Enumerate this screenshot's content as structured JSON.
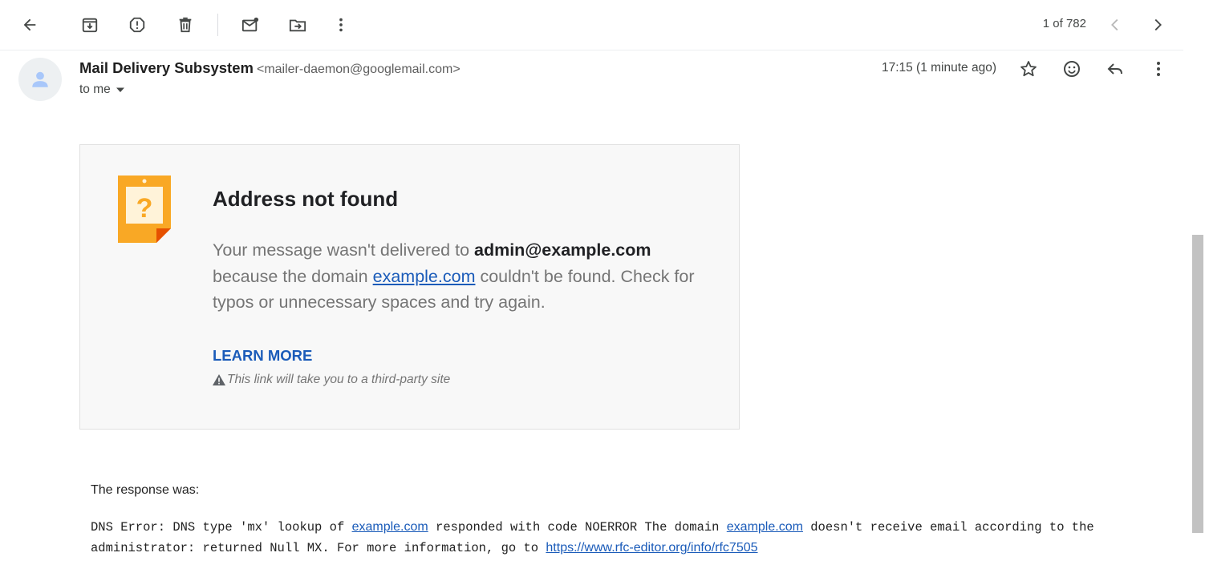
{
  "toolbar": {
    "back_icon": "arrow-left-icon",
    "archive_icon": "archive-icon",
    "spam_icon": "report-spam-icon",
    "delete_icon": "trash-icon",
    "unread_icon": "mark-unread-icon",
    "move_icon": "move-to-icon",
    "more_icon": "more-vert-icon",
    "counter": "1 of 782",
    "prev_icon": "chevron-left-icon",
    "next_icon": "chevron-right-icon"
  },
  "message": {
    "sender_name": "Mail Delivery Subsystem",
    "sender_email": "<mailer-daemon@googlemail.com>",
    "to_label": "to me",
    "time": "17:15 (1 minute ago)",
    "star_icon": "star-icon",
    "emoji_icon": "emoji-icon",
    "reply_icon": "reply-icon",
    "more_icon": "more-vert-icon"
  },
  "card": {
    "title": "Address not found",
    "body_pre": "Your message wasn't delivered to ",
    "address": "admin@example.com",
    "body_mid": " because the domain ",
    "domain_link": "example.com",
    "body_post": " couldn't be found. Check for typos or unnecessary spaces and try again.",
    "learn_more": "LEARN MORE",
    "warning": "This link will take you to a third-party site"
  },
  "response": {
    "label": "The response was:",
    "part1": "DNS Error: DNS type 'mx' lookup of ",
    "link1": "example.com",
    "part2": " responded with code NOERROR The domain ",
    "link2": "example.com",
    "part3": " doesn't receive email according to the administrator: returned Null MX. For more information, go to ",
    "link3": "https://www.rfc-editor.org/info/rfc7505"
  },
  "colors": {
    "link": "#1a5bb9",
    "icon_orange": "#f9a825",
    "card_bg": "#f8f8f8"
  }
}
